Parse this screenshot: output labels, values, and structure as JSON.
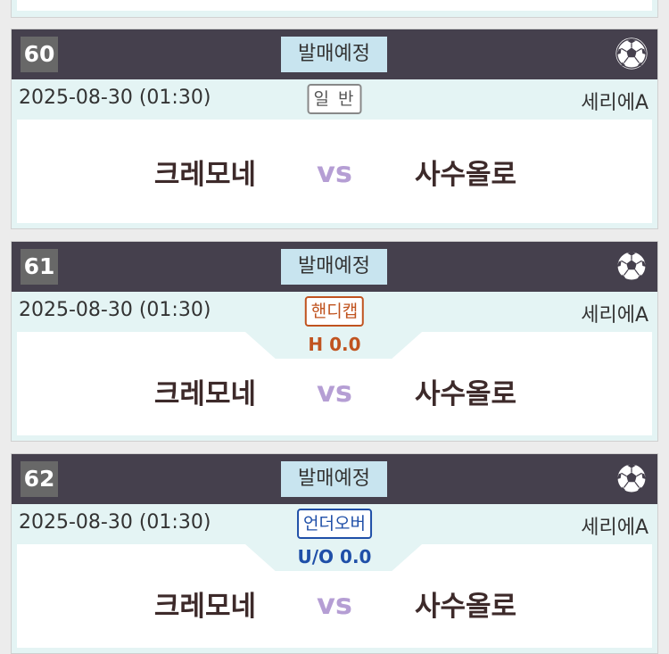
{
  "games": [
    {
      "number": "60",
      "status": "발매예정",
      "datetime": "2025-08-30 (01:30)",
      "bet_type": "일 반",
      "bet_type_kind": "normal",
      "line": "",
      "league": "세리에A",
      "home": "크레모네",
      "vs": "vs",
      "away": "사수올로"
    },
    {
      "number": "61",
      "status": "발매예정",
      "datetime": "2025-08-30 (01:30)",
      "bet_type": "핸디캡",
      "bet_type_kind": "handicap",
      "line": "H 0.0",
      "league": "세리에A",
      "home": "크레모네",
      "vs": "vs",
      "away": "사수올로"
    },
    {
      "number": "62",
      "status": "발매예정",
      "datetime": "2025-08-30 (01:30)",
      "bet_type": "언더오버",
      "bet_type_kind": "overunder",
      "line": "U/O 0.0",
      "league": "세리에A",
      "home": "크레모네",
      "vs": "vs",
      "away": "사수올로"
    }
  ],
  "icons": {
    "sport": "soccer-ball-icon"
  },
  "colors": {
    "header_bg": "#45404d",
    "number_bg": "#686868",
    "status_bg": "#c8e4ef",
    "info_bg": "#e4f4f4",
    "handicap": "#c0531f",
    "overunder": "#1f4fa8",
    "vs": "#b59ed4"
  }
}
